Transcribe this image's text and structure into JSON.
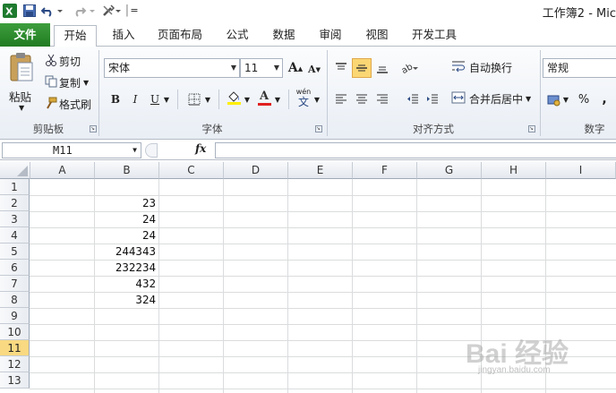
{
  "title_bar": {
    "title": "工作簿2 - Mic",
    "qa_separator": "|",
    "qa_more": "="
  },
  "tabs": [
    {
      "label": "文件"
    },
    {
      "label": "开始"
    },
    {
      "label": "插入"
    },
    {
      "label": "页面布局"
    },
    {
      "label": "公式"
    },
    {
      "label": "数据"
    },
    {
      "label": "审阅"
    },
    {
      "label": "视图"
    },
    {
      "label": "开发工具"
    }
  ],
  "ribbon": {
    "clipboard": {
      "paste": "粘贴",
      "cut": "剪切",
      "copy": "复制",
      "format_painter": "格式刷",
      "group": "剪贴板"
    },
    "font": {
      "name": "宋体",
      "size": "11",
      "bold": "B",
      "italic": "I",
      "underline": "U",
      "group": "字体",
      "grow": "A",
      "shrink": "A",
      "font_color": "A",
      "phonetic": "wén",
      "phonetic_char": "文"
    },
    "alignment": {
      "wrap": "自动换行",
      "merge": "合并后居中",
      "group": "对齐方式"
    },
    "number": {
      "format": "常规",
      "percent": "%",
      "comma": ",",
      "group": "数字"
    }
  },
  "formula_bar": {
    "name_box": "M11",
    "fx": "fx",
    "formula": ""
  },
  "sheet": {
    "columns": [
      "A",
      "B",
      "C",
      "D",
      "E",
      "F",
      "G",
      "H",
      "I"
    ],
    "rows": [
      "1",
      "2",
      "3",
      "4",
      "5",
      "6",
      "7",
      "8",
      "9",
      "10",
      "11",
      "12",
      "13"
    ],
    "selected_row": "11",
    "column_b_values": [
      "",
      "23",
      "24",
      "24",
      "244343",
      "232234",
      "432",
      "324"
    ]
  },
  "watermark": {
    "text": "Bai 经验",
    "sub": "jingyan.baidu.com"
  },
  "colors": {
    "file_tab": "#2a842a",
    "selected_header": "#f9d981",
    "ribbon_bg": "#eef2f7",
    "font_color_bar": "#e02020",
    "highlight_bar": "#ffee00"
  }
}
